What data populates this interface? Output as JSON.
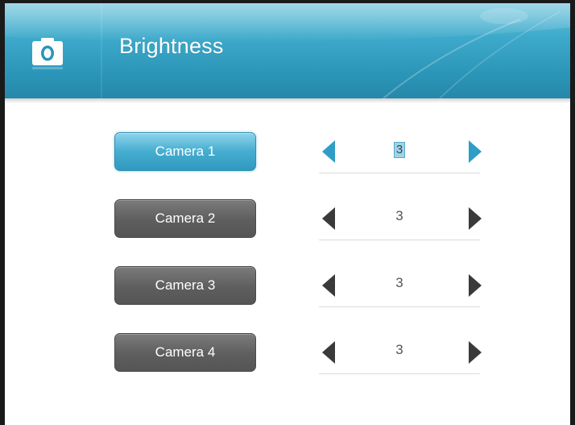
{
  "header": {
    "title": "Brightness",
    "icon": "camera-icon"
  },
  "cameras": [
    {
      "label": "Camera 1",
      "value": "3",
      "selected": true
    },
    {
      "label": "Camera 2",
      "value": "3",
      "selected": false
    },
    {
      "label": "Camera 3",
      "value": "3",
      "selected": false
    },
    {
      "label": "Camera 4",
      "value": "3",
      "selected": false
    }
  ],
  "colors": {
    "accent": "#3ea8cb",
    "inactive_button": "#5e5e5e",
    "arrow_inactive": "#3a3a3a",
    "arrow_active": "#2f9dc6"
  }
}
